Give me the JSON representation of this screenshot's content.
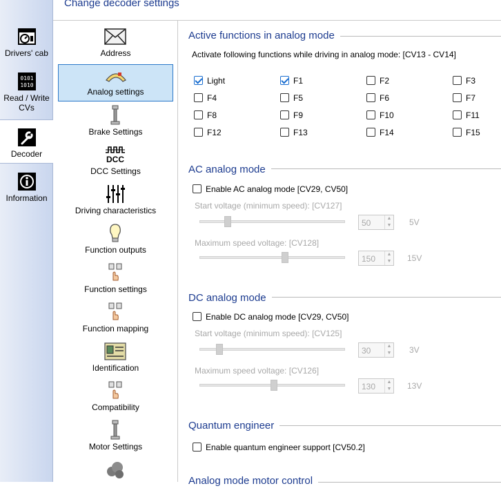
{
  "left_bar": {
    "items": [
      {
        "label": "Drivers' cab",
        "icon": "drivers-cab-icon"
      },
      {
        "label": "Read / Write CVs",
        "icon": "binary-icon"
      },
      {
        "label": "Decoder",
        "icon": "wrench-icon"
      },
      {
        "label": "Information",
        "icon": "information-icon"
      }
    ]
  },
  "header": {
    "title": "Change decoder settings"
  },
  "nav": {
    "items": [
      {
        "label": "Address",
        "icon": "envelope-icon"
      },
      {
        "label": "Analog settings",
        "icon": "gauge-icon"
      },
      {
        "label": "Brake Settings",
        "icon": "brake-icon"
      },
      {
        "label": "DCC Settings",
        "icon": "dcc-icon",
        "icon_text": "DCC"
      },
      {
        "label": "Driving characteristics",
        "icon": "sliders-icon"
      },
      {
        "label": "Function outputs",
        "icon": "lightbulb-icon"
      },
      {
        "label": "Function settings",
        "icon": "function-keys-icon"
      },
      {
        "label": "Function mapping",
        "icon": "function-keys-icon"
      },
      {
        "label": "Identification",
        "icon": "id-card-icon"
      },
      {
        "label": "Compatibility",
        "icon": "function-keys-icon"
      },
      {
        "label": "Motor Settings",
        "icon": "brake-icon"
      },
      {
        "label": "",
        "icon": "smoke-icon"
      }
    ]
  },
  "active_functions": {
    "title": "Active functions in analog mode",
    "description": "Activate following functions while driving in analog mode: [CV13 - CV14]",
    "functions": [
      {
        "label": "Light",
        "checked": true
      },
      {
        "label": "F1",
        "checked": true
      },
      {
        "label": "F2",
        "checked": false
      },
      {
        "label": "F3",
        "checked": false
      },
      {
        "label": "F4",
        "checked": false
      },
      {
        "label": "F5",
        "checked": false
      },
      {
        "label": "F6",
        "checked": false
      },
      {
        "label": "F7",
        "checked": false
      },
      {
        "label": "F8",
        "checked": false
      },
      {
        "label": "F9",
        "checked": false
      },
      {
        "label": "F10",
        "checked": false
      },
      {
        "label": "F11",
        "checked": false
      },
      {
        "label": "F12",
        "checked": false
      },
      {
        "label": "F13",
        "checked": false
      },
      {
        "label": "F14",
        "checked": false
      },
      {
        "label": "F15",
        "checked": false
      }
    ]
  },
  "ac_mode": {
    "title": "AC analog mode",
    "enable_label": "Enable AC analog mode [CV29, CV50]",
    "enabled": false,
    "start_label": "Start voltage (minimum speed): [CV127]",
    "start_value": "50",
    "start_unit": "5V",
    "start_level": 0.18,
    "max_label": "Maximum speed voltage: [CV128]",
    "max_value": "150",
    "max_unit": "15V",
    "max_level": 0.59
  },
  "dc_mode": {
    "title": "DC analog mode",
    "enable_label": "Enable DC analog mode [CV29, CV50]",
    "enabled": false,
    "start_label": "Start voltage (minimum speed): [CV125]",
    "start_value": "30",
    "start_unit": "3V",
    "start_level": 0.12,
    "max_label": "Maximum speed voltage: [CV126]",
    "max_value": "130",
    "max_unit": "13V",
    "max_level": 0.51
  },
  "quantum": {
    "title": "Quantum engineer",
    "enable_label": "Enable quantum engineer support [CV50.2]",
    "enabled": false
  },
  "next_section": {
    "title": "Analog mode motor control"
  },
  "spinner": {
    "up": "▲",
    "down": "▼"
  }
}
